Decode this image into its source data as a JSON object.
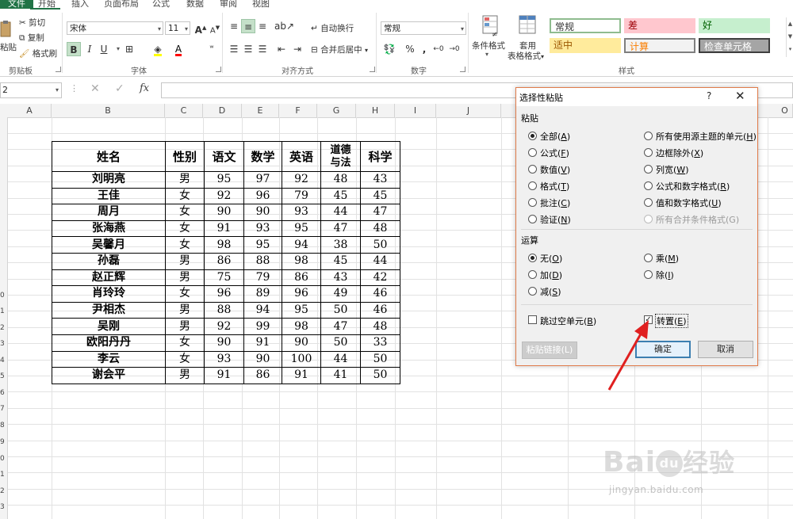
{
  "menu": {
    "tabs": [
      "文件",
      "开始",
      "插入",
      "页面布局",
      "公式",
      "数据",
      "审阅",
      "视图"
    ]
  },
  "ribbon": {
    "clipboard": {
      "paste": "粘贴",
      "cut": "剪切",
      "copy": "复制",
      "format_painter": "格式刷",
      "label": "剪贴板"
    },
    "font": {
      "name": "宋体",
      "size": "11",
      "label": "字体",
      "bold": "B",
      "italic": "I",
      "underline": "U",
      "grow": "A",
      "shrink": "A",
      "font_color_letter": "A"
    },
    "alignment": {
      "wrap": "自动换行",
      "merge": "合并后居中",
      "label": "对齐方式"
    },
    "number": {
      "format": "常规",
      "percent": "%",
      "comma": ",",
      "label": "数字"
    },
    "styles": {
      "conditional": "条件格式",
      "table_format_1": "套用",
      "table_format_2": "表格格式",
      "label": "样式",
      "cells": [
        {
          "text": "常规",
          "bg": "#ffffff",
          "fg": "#333333",
          "border": "#8fbc8f"
        },
        {
          "text": "差",
          "bg": "#ffc7ce",
          "fg": "#9c0006"
        },
        {
          "text": "好",
          "bg": "#c6efce",
          "fg": "#006100"
        },
        {
          "text": "适中",
          "bg": "#ffeb9c",
          "fg": "#9c5700"
        },
        {
          "text": "计算",
          "bg": "#f2f2f2",
          "fg": "#fa7d00",
          "border": "#7f7f7f"
        },
        {
          "text": "检查单元格",
          "bg": "#a5a5a5",
          "fg": "#ffffff",
          "border": "#3f3f3f"
        }
      ]
    }
  },
  "formula_bar": {
    "name_box": "2",
    "fx": "fx"
  },
  "grid": {
    "columns": [
      "A",
      "B",
      "C",
      "D",
      "E",
      "F",
      "G",
      "H",
      "I",
      "J",
      "O"
    ],
    "row_numbers": [
      "0",
      "1",
      "2",
      "3",
      "4",
      "5",
      "6",
      "7",
      "8",
      "9",
      "0",
      "1",
      "2",
      "3"
    ]
  },
  "table": {
    "headers": [
      "姓名",
      "性别",
      "语文",
      "数学",
      "英语",
      "道德\n与法",
      "科学"
    ],
    "rows": [
      [
        "刘明亮",
        "男",
        "95",
        "97",
        "92",
        "48",
        "43"
      ],
      [
        "王佳",
        "女",
        "92",
        "96",
        "79",
        "45",
        "45"
      ],
      [
        "周月",
        "女",
        "90",
        "90",
        "93",
        "44",
        "47"
      ],
      [
        "张海燕",
        "女",
        "91",
        "93",
        "95",
        "47",
        "48"
      ],
      [
        "吴馨月",
        "女",
        "98",
        "95",
        "94",
        "38",
        "50"
      ],
      [
        "孙磊",
        "男",
        "86",
        "88",
        "98",
        "45",
        "44"
      ],
      [
        "赵正辉",
        "男",
        "75",
        "79",
        "86",
        "43",
        "42"
      ],
      [
        "肖玲玲",
        "女",
        "96",
        "89",
        "96",
        "49",
        "46"
      ],
      [
        "尹相杰",
        "男",
        "88",
        "94",
        "95",
        "50",
        "46"
      ],
      [
        "吴刚",
        "男",
        "92",
        "99",
        "98",
        "47",
        "48"
      ],
      [
        "欧阳丹丹",
        "女",
        "90",
        "91",
        "90",
        "50",
        "33"
      ],
      [
        "李云",
        "女",
        "93",
        "90",
        "100",
        "44",
        "50"
      ],
      [
        "谢会平",
        "男",
        "91",
        "86",
        "91",
        "41",
        "50"
      ]
    ]
  },
  "dialog": {
    "title": "选择性粘贴",
    "help": "?",
    "close": "✕",
    "paste_section": "粘贴",
    "paste_left": [
      {
        "text": "全部(",
        "key": "A",
        "end": ")",
        "checked": true
      },
      {
        "text": "公式(",
        "key": "F",
        "end": ")"
      },
      {
        "text": "数值(",
        "key": "V",
        "end": ")"
      },
      {
        "text": "格式(",
        "key": "T",
        "end": ")"
      },
      {
        "text": "批注(",
        "key": "C",
        "end": ")"
      },
      {
        "text": "验证(",
        "key": "N",
        "end": ")"
      }
    ],
    "paste_right": [
      {
        "text": "所有使用源主题的单元(",
        "key": "H",
        "end": ")"
      },
      {
        "text": "边框除外(",
        "key": "X",
        "end": ")"
      },
      {
        "text": "列宽(",
        "key": "W",
        "end": ")"
      },
      {
        "text": "公式和数字格式(",
        "key": "R",
        "end": ")"
      },
      {
        "text": "值和数字格式(",
        "key": "U",
        "end": ")"
      },
      {
        "text": "所有合并条件格式(G)",
        "key": "",
        "end": "",
        "disabled": true
      }
    ],
    "op_section": "运算",
    "op_left": [
      {
        "text": "无(",
        "key": "O",
        "end": ")",
        "checked": true
      },
      {
        "text": "加(",
        "key": "D",
        "end": ")"
      },
      {
        "text": "减(",
        "key": "S",
        "end": ")"
      }
    ],
    "op_right": [
      {
        "text": "乘(",
        "key": "M",
        "end": ")"
      },
      {
        "text": "除(",
        "key": "I",
        "end": ")"
      }
    ],
    "skip_blanks": {
      "text": "跳过空单元(",
      "key": "B",
      "end": ")",
      "checked": false
    },
    "transpose": {
      "text": "转置(",
      "key": "E",
      "end": ")",
      "checked": true
    },
    "paste_link": "粘贴链接(L)",
    "ok": "确定",
    "cancel": "取消"
  },
  "watermark": {
    "brand": "Bai",
    "paw": "du",
    "cn": "经验",
    "url": "jingyan.baidu.com"
  },
  "colors": {
    "excel_green": "#217346",
    "annotation_red": "#e02020"
  }
}
